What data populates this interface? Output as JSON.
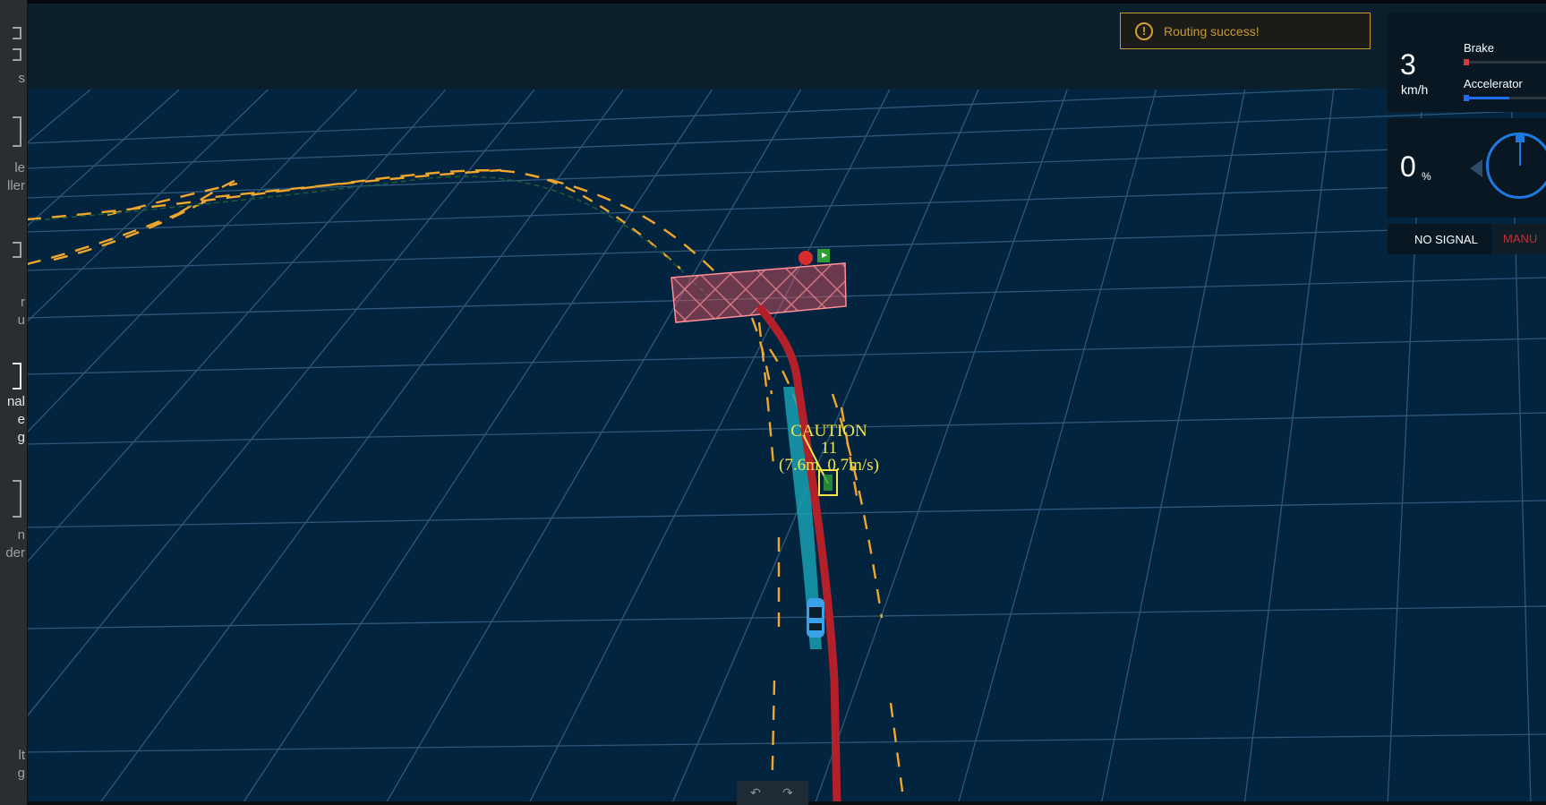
{
  "sidebar": {
    "items": [
      {
        "id": "tasks",
        "label": "s"
      },
      {
        "id": "vehicle",
        "label": "le\nller"
      },
      {
        "id": "route",
        "label": "r\nu"
      },
      {
        "id": "signal",
        "label": "nal\ne\ng"
      },
      {
        "id": "recorder",
        "label": "n\nder"
      },
      {
        "id": "default",
        "label": "lt\ng"
      }
    ]
  },
  "notification": {
    "text": "Routing success!",
    "icon": "warning-icon"
  },
  "speed_panel": {
    "speed": "3",
    "speed_unit": "km/h",
    "brake_label": "Brake",
    "brake_level": 0.05,
    "accelerator_label": "Accelerator",
    "accelerator_level": 0.55
  },
  "steering_panel": {
    "value": "0",
    "unit": "%",
    "angle_deg": 0
  },
  "signal_panel": {
    "signal": "NO SIGNAL",
    "driving_mode": "MANU"
  },
  "obstacle_label": {
    "line1": "CAUTION",
    "line2": "11",
    "line3": "(7.6m, 0.7m/s)"
  },
  "colors": {
    "ground": "#03243f",
    "grid": "#3b6a8f",
    "lane": "#f1a72c",
    "planning": "#19a0b1",
    "routing": "#b32029",
    "stop_fence": "#e8545f",
    "caution_text": "#f4e54a",
    "brake": "#d03a45",
    "accelerator": "#1f6df0"
  },
  "icons": {
    "stop": "stop-sign-icon",
    "destination": "green-flag-icon",
    "vehicle": "ego-car-icon"
  }
}
